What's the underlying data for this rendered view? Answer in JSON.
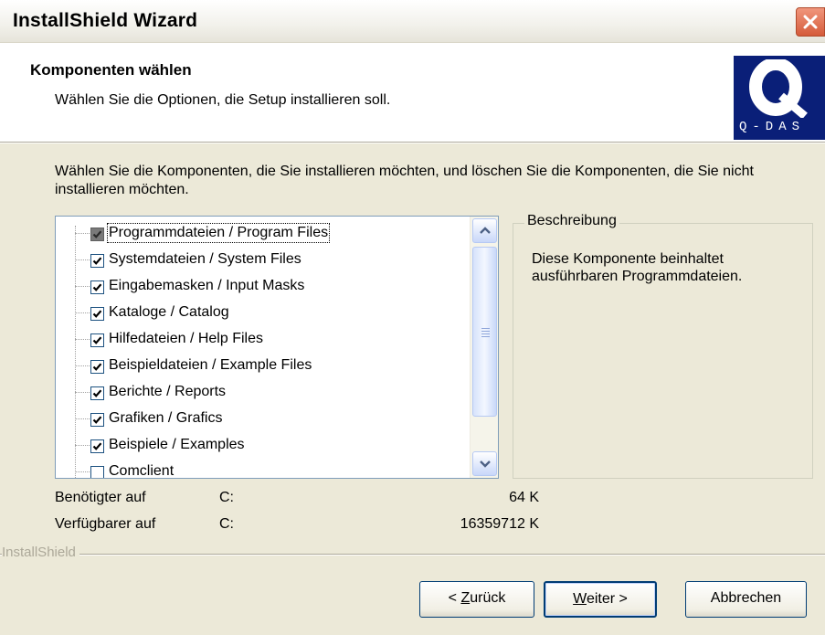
{
  "window": {
    "title": "InstallShield Wizard"
  },
  "header": {
    "title": "Komponenten wählen",
    "subtitle": "Wählen Sie die Optionen, die Setup installieren soll.",
    "logo_text": "Q-DAS",
    "logo_color": "#0A1F78"
  },
  "instructions": "Wählen Sie die Komponenten, die Sie installieren möchten, und löschen Sie die Komponenten, die Sie nicht installieren möchten.",
  "components": [
    {
      "label": "Programmdateien / Program Files",
      "state": "checked-grayed",
      "selected": true
    },
    {
      "label": "Systemdateien / System Files",
      "state": "checked"
    },
    {
      "label": "Eingabemasken / Input Masks",
      "state": "checked"
    },
    {
      "label": "Kataloge / Catalog",
      "state": "checked"
    },
    {
      "label": "Hilfedateien / Help Files",
      "state": "checked"
    },
    {
      "label": "Beispieldateien / Example Files",
      "state": "checked"
    },
    {
      "label": "Berichte / Reports",
      "state": "checked"
    },
    {
      "label": "Grafiken / Grafics",
      "state": "checked"
    },
    {
      "label": "Beispiele / Examples",
      "state": "checked"
    },
    {
      "label": "Comclient",
      "state": "unchecked"
    }
  ],
  "description": {
    "legend": "Beschreibung",
    "text": "Diese Komponente beinhaltet ausführbaren Programmdateien."
  },
  "space": {
    "required": {
      "label": "Benötigter auf",
      "drive": "C:",
      "value": "64 K"
    },
    "available": {
      "label": "Verfügbarer auf",
      "drive": "C:",
      "value": "16359712 K"
    }
  },
  "brand": "InstallShield",
  "buttons": {
    "back_prefix": "< ",
    "back_key": "Z",
    "back_rest": "urück",
    "next_key": "W",
    "next_rest": "eiter >",
    "cancel": "Abbrechen"
  }
}
